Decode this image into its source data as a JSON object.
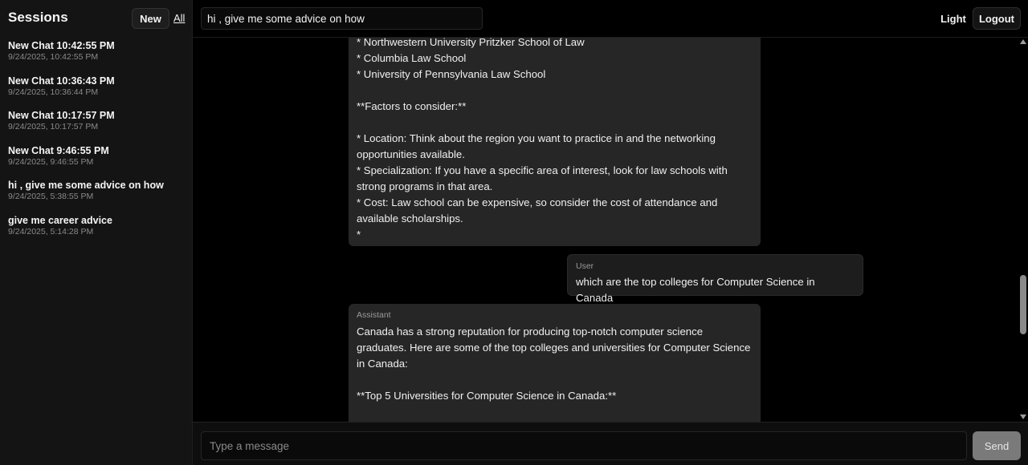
{
  "sidebar": {
    "title": "Sessions",
    "new_label": "New",
    "all_label": "All",
    "sessions": [
      {
        "title": "New Chat 10:42:55 PM",
        "date": "9/24/2025, 10:42:55 PM"
      },
      {
        "title": "New Chat 10:36:43 PM",
        "date": "9/24/2025, 10:36:44 PM"
      },
      {
        "title": "New Chat 10:17:57 PM",
        "date": "9/24/2025, 10:17:57 PM"
      },
      {
        "title": "New Chat 9:46:55 PM",
        "date": "9/24/2025, 9:46:55 PM"
      },
      {
        "title": "hi , give me some advice on how",
        "date": "9/24/2025, 5:38:55 PM"
      },
      {
        "title": "give me career advice",
        "date": "9/24/2025, 5:14:28 PM"
      }
    ]
  },
  "topbar": {
    "title_value": "hi , give me some advice on how",
    "light_label": "Light",
    "logout_label": "Logout"
  },
  "messages": [
    {
      "role": "",
      "text": "* Northwestern University Pritzker School of Law\n* Columbia Law School\n* University of Pennsylvania Law School\n\n**Factors to consider:**\n\n* Location: Think about the region you want to practice in and the networking\nopportunities available.\n* Specialization: If you have a specific area of interest, look for law schools with\nstrong programs in that area.\n* Cost: Law school can be expensive, so consider the cost of attendance and\navailable scholarships.\n*"
    },
    {
      "role": "User",
      "text": "which are the top colleges for Computer Science in Canada"
    },
    {
      "role": "Assistant",
      "text": "Canada has a strong reputation for producing top-notch computer science\ngraduates. Here are some of the top colleges and universities for Computer Science\nin Canada:\n\n**Top 5 Universities for Computer Science in Canada:**"
    }
  ],
  "composer": {
    "placeholder": "Type a message",
    "send_label": "Send"
  }
}
